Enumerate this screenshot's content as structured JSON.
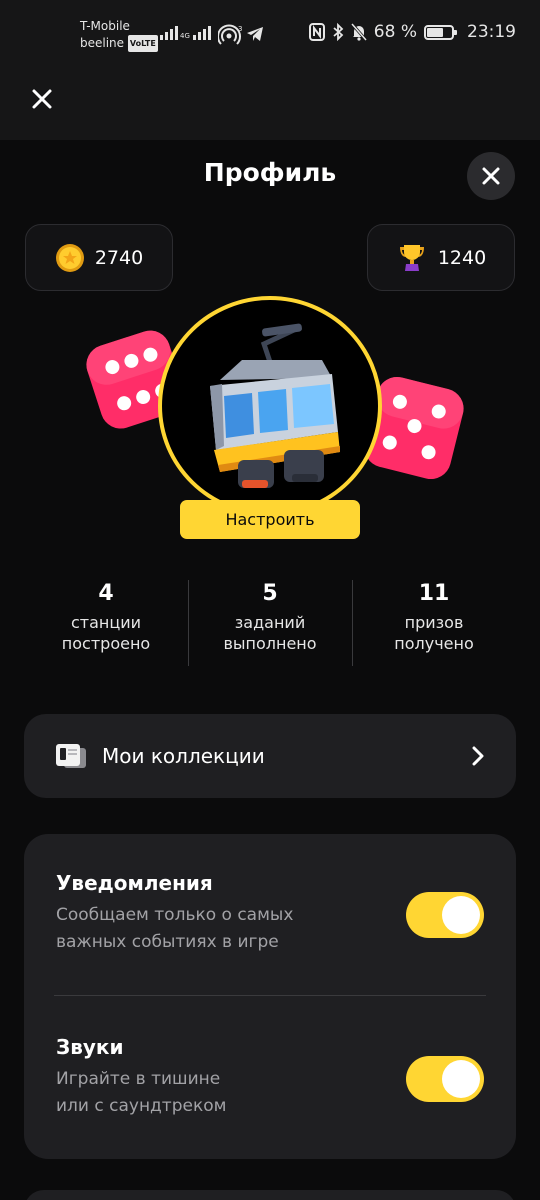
{
  "status_bar": {
    "carrier_1": "T-Mobile",
    "carrier_2": "beeline",
    "volte": "VoLTE",
    "net_label": "4G",
    "hotspot_count": "3",
    "battery": "68 %",
    "battery_level": 0.68,
    "time": "23:19"
  },
  "profile": {
    "title": "Профиль",
    "coins": "2740",
    "trophies": "1240",
    "customize_label": "Настроить"
  },
  "stats": [
    {
      "value": "4",
      "label_1": "станции",
      "label_2": "построено"
    },
    {
      "value": "5",
      "label_1": "заданий",
      "label_2": "выполнено"
    },
    {
      "value": "11",
      "label_1": "призов",
      "label_2": "получено"
    }
  ],
  "collections": {
    "label": "Мои коллекции"
  },
  "settings": [
    {
      "title": "Уведомления",
      "desc": "Сообщаем только о самых важных событиях в игре",
      "enabled": true
    },
    {
      "title": "Звуки",
      "desc_1": "Играйте в тишине",
      "desc_2": "или с саундтреком",
      "enabled": true
    }
  ],
  "colors": {
    "accent": "#ffd633",
    "card": "#1f1f22",
    "background": "#0b0b0c",
    "dice": "#ff2d68"
  },
  "icons": [
    "close-icon",
    "coin-icon",
    "trophy-icon",
    "dice-icon",
    "tram-avatar",
    "book-icon",
    "chevron-right-icon"
  ]
}
